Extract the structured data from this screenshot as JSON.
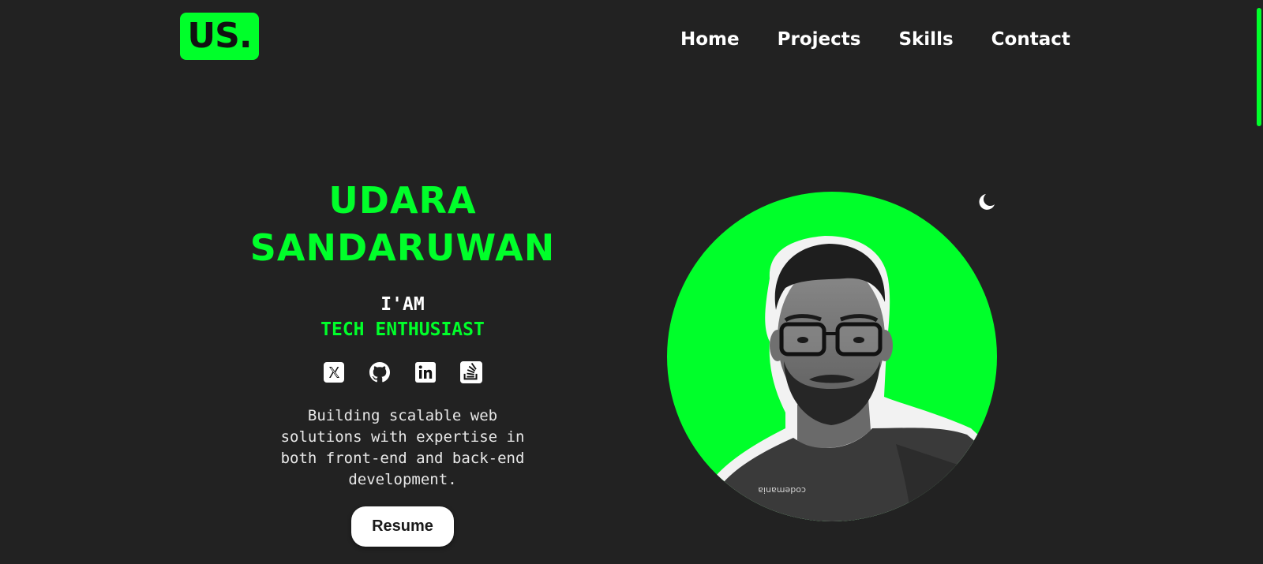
{
  "brand": {
    "logo_text": "US.",
    "accent_color": "#00ff2a",
    "background_color": "#222222"
  },
  "nav": {
    "items": [
      {
        "label": "Home"
      },
      {
        "label": "Projects"
      },
      {
        "label": "Skills"
      },
      {
        "label": "Contact"
      }
    ]
  },
  "hero": {
    "name_line1": "UDARA",
    "name_line2": "SANDARUWAN",
    "intro": "I'AM",
    "role": "TECH ENTHUSIAST",
    "description": "Building scalable web solutions with expertise in both front-end and back-end development.",
    "resume_label": "Resume",
    "socials": [
      {
        "icon": "x-twitter-icon"
      },
      {
        "icon": "github-icon"
      },
      {
        "icon": "linkedin-icon"
      },
      {
        "icon": "stackoverflow-icon"
      }
    ],
    "shirt_text": "codemania"
  },
  "theme_toggle": {
    "icon": "moon-icon"
  }
}
